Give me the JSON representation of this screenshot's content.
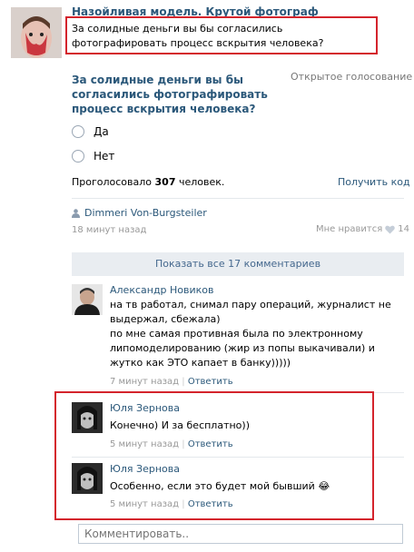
{
  "post": {
    "group_name": "Назойливая модель. Крутой фотограф",
    "text": "За солидные деньги вы бы согласились фотографировать процесс вскрытия человека?"
  },
  "poll": {
    "question": "За солидные деньги вы бы согласились фотографировать процесс вскрытия человека?",
    "type_label": "Открытое голосование",
    "options": [
      "Да",
      "Нет"
    ],
    "votes_prefix": "Проголосовало",
    "votes_count": "307",
    "votes_suffix": "человек.",
    "get_code": "Получить код"
  },
  "author": {
    "name": "Dimmeri Von-Burgsteiler",
    "time": "18 минут назад",
    "like_label": "Мне нравится",
    "like_count": "14"
  },
  "comments_bar": {
    "label": "Показать все 17 комментариев"
  },
  "comments": [
    {
      "name": "Александр Новиков",
      "lines": [
        "на тв работал, снимал пару операций, журналист не выдержал, сбежала)",
        "по мне самая противная была по электронному липомоделированию (жир из попы выкачивали) и жутко как ЭТО капает в банку)))))"
      ],
      "time": "7 минут назад",
      "separator": "|",
      "reply": "Ответить"
    },
    {
      "name": "Юля Зернова",
      "lines": [
        "Конечно) И за бесплатно))"
      ],
      "time": "5 минут назад",
      "separator": "|",
      "reply": "Ответить"
    },
    {
      "name": "Юля Зернова",
      "lines": [
        "Особенно, если это будет мой бывший"
      ],
      "emoji": "😂",
      "time": "5 минут назад",
      "separator": "|",
      "reply": "Ответить"
    }
  ],
  "comment_input": {
    "placeholder": "Комментировать.."
  },
  "colors": {
    "link": "#2b587a",
    "highlight": "#d4242c",
    "bar": "#e9edf1"
  }
}
